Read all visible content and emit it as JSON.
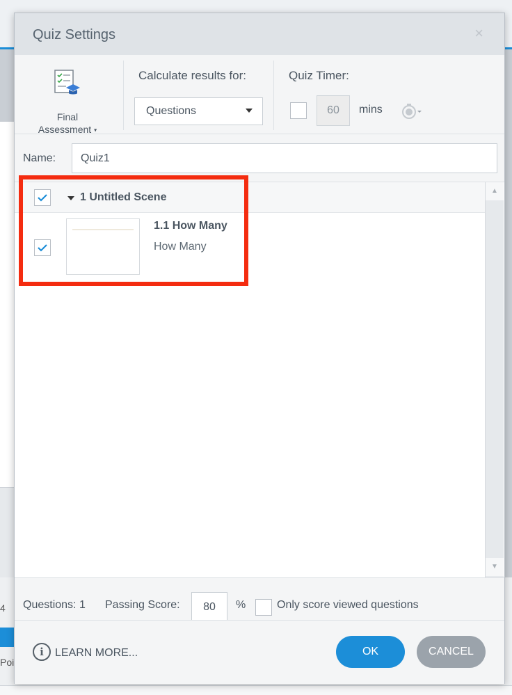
{
  "background": {
    "left_text_1": "4",
    "left_text_2": "Poi."
  },
  "dialog": {
    "title": "Quiz Settings",
    "close_glyph": "×"
  },
  "toolbar": {
    "assessment": {
      "line1": "Final",
      "line2": "Assessment",
      "caret": "▾"
    },
    "calculate": {
      "label": "Calculate results for:",
      "selected": "Questions"
    },
    "timer": {
      "label": "Quiz Timer:",
      "value": "60",
      "unit": "mins"
    }
  },
  "name": {
    "label": "Name:",
    "value": "Quiz1"
  },
  "list": {
    "scene": {
      "title": "1 Untitled Scene"
    },
    "slide": {
      "title": "1.1 How Many",
      "subtitle": "How Many"
    },
    "scroll_up": "▲",
    "scroll_down": "▼"
  },
  "footer": {
    "questions_label": "Questions:",
    "questions_count": "1",
    "passing_label": "Passing Score:",
    "passing_value": "80",
    "percent": "%",
    "only_viewed": "Only score viewed questions",
    "info_glyph": "i",
    "learn_more": "LEARN MORE...",
    "ok": "OK",
    "cancel": "CANCEL"
  },
  "colors": {
    "accent": "#1c8ed8",
    "highlight": "#f42c10",
    "cancel": "#9ba3ab"
  }
}
